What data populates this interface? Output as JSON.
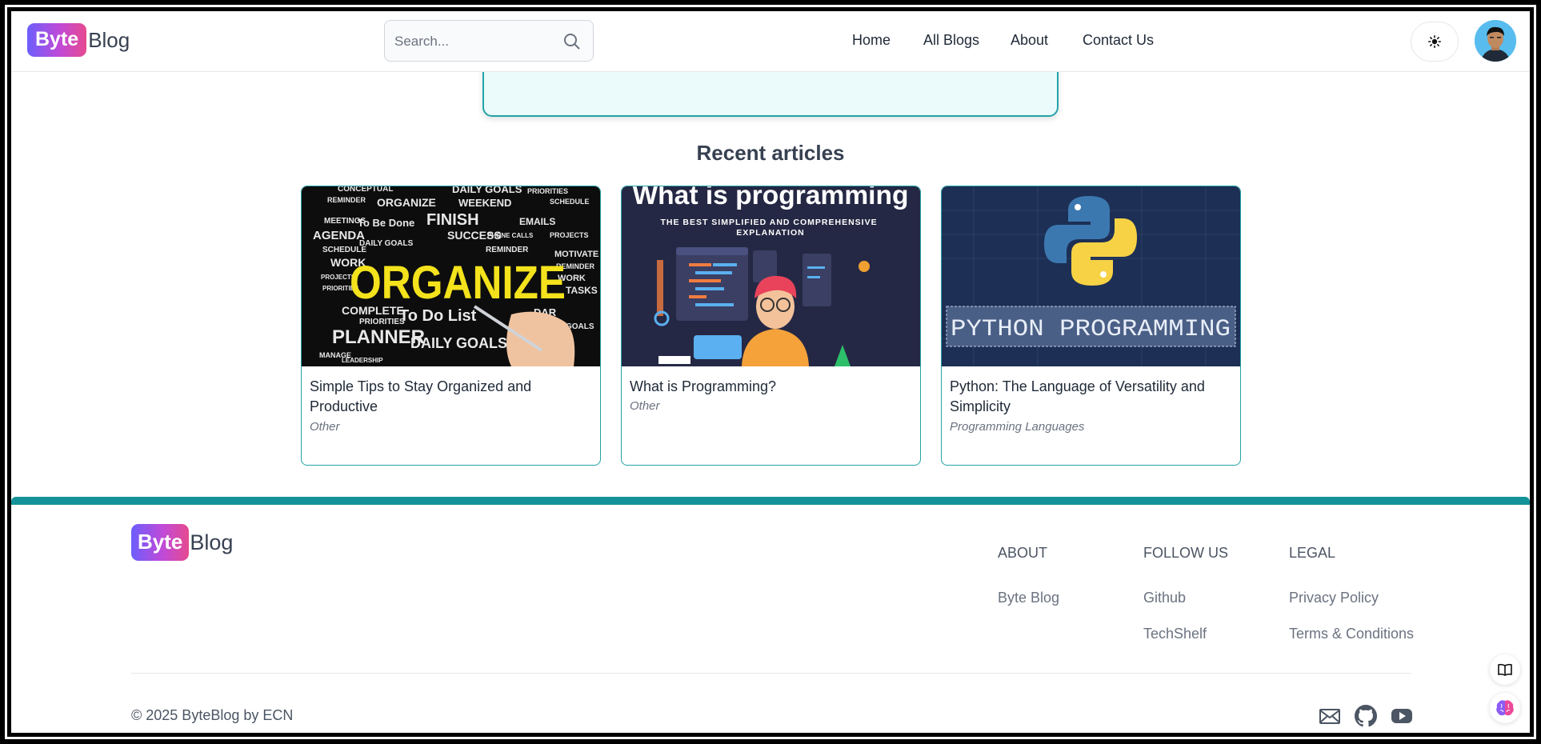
{
  "navbar": {
    "logo": {
      "byte": "Byte",
      "blog": "Blog"
    },
    "search": {
      "placeholder": "Search..."
    },
    "links": [
      "Home",
      "All Blogs",
      "About",
      "Contact Us"
    ],
    "theme_icon": "sun-icon",
    "avatar_icon": "user-avatar"
  },
  "main": {
    "section_title": "Recent articles",
    "articles": [
      {
        "title": "Simple Tips to Stay Organized and Productive",
        "category": "Other",
        "thumb_icon": "organize-word-cloud-image"
      },
      {
        "title": "What is Programming?",
        "category": "Other",
        "thumb_icon": "what-is-programming-illustration",
        "thumb_text": {
          "headline": "What is programming",
          "subhead": "THE BEST SIMPLIFIED AND COMPREHENSIVE EXPLANATION"
        }
      },
      {
        "title": "Python: The Language of Versatility and Simplicity",
        "category": "Programming Languages",
        "thumb_icon": "python-logo-image",
        "thumb_text": {
          "banner": "PYTHON PROGRAMMING"
        }
      }
    ]
  },
  "footer": {
    "logo": {
      "byte": "Byte",
      "blog": "Blog"
    },
    "columns": [
      {
        "heading": "ABOUT",
        "links": [
          "Byte Blog"
        ]
      },
      {
        "heading": "FOLLOW US",
        "links": [
          "Github",
          "TechShelf"
        ]
      },
      {
        "heading": "LEGAL",
        "links": [
          "Privacy Policy",
          "Terms & Conditions"
        ]
      }
    ],
    "copyright": "© 2025 ByteBlog by ECN",
    "social_icons": [
      "mail-icon",
      "github-icon",
      "youtube-icon"
    ]
  },
  "floating_buttons": [
    "book-icon",
    "brain-icon"
  ],
  "colors": {
    "accent_teal": "#14929a",
    "hero_bg": "#ebfbfb",
    "logo_gradient_start": "#6d5efc",
    "logo_gradient_end": "#e64a8f"
  }
}
